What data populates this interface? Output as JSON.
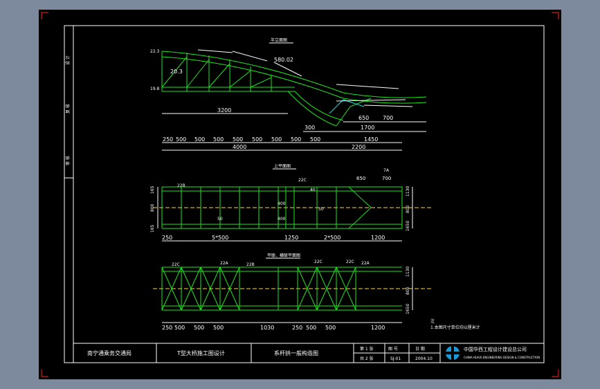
{
  "title_block": {
    "client": "南宁通乘务交通局",
    "project": "T型大桥施工图设计",
    "drawing_title": "系杆拱一般构造图",
    "sheet_label": "第 1 张",
    "total_label": "共 2 张",
    "drawing_no_label": "图 号",
    "drawing_no": "SJ-01",
    "date_label": "日 期",
    "date": "2004.10",
    "company": "中国华西工程设计建设总公司",
    "company_en": "CHINA HUAXI ENGINEERING DESIGN & CONSTRUCTION"
  },
  "side_stamps": [
    "设 计",
    "复 核",
    "审 核"
  ],
  "views": {
    "elevation_title": "半立面图",
    "plan_title": "上平面图",
    "bottom_plan_title": "平联、横联平面图"
  },
  "elevation": {
    "top_left_labels": [
      "22.3",
      "20.3",
      "19.8"
    ],
    "dim_580": "580.02",
    "dim_3200": "3200",
    "dim_300": "300",
    "dim_1700": "1700",
    "dim_650": "650",
    "dim_700": "700",
    "dim_row": [
      "250",
      "500",
      "500",
      "500",
      "500",
      "500",
      "500",
      "500",
      "500",
      "1450"
    ],
    "dim_4000": "4000",
    "dim_2200": "2200"
  },
  "plan": {
    "labels": [
      "22B",
      "22C",
      "7A",
      "650",
      "700",
      "40",
      "50",
      "400",
      "400",
      "50"
    ],
    "left_dims": [
      "165",
      "800",
      "165"
    ],
    "right_dims": [
      "1130",
      "800",
      "1650"
    ],
    "bottom_dims": [
      "250",
      "5*500",
      "1250",
      "2*500",
      "1200"
    ]
  },
  "bottom_plan": {
    "labels": [
      "22C",
      "22A",
      "22B",
      "22C",
      "22C",
      "22A"
    ],
    "bottom_dims": [
      "250",
      "500",
      "500",
      "500",
      "1030",
      "250",
      "500",
      "500",
      "1200"
    ],
    "right_dims": [
      "1130",
      "800",
      "1650"
    ]
  },
  "note": {
    "title": "注",
    "line1": "1.本图尺寸单位均以厘米计"
  }
}
